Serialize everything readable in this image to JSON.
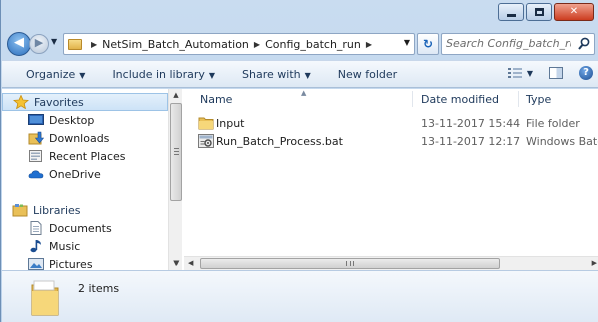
{
  "search": {
    "placeholder": "Search Config_batch_run"
  },
  "address": {
    "crumbs": [
      "NetSim_Batch_Automation",
      "Config_batch_run"
    ]
  },
  "toolbar": {
    "organize": "Organize",
    "include_in_library": "Include in library",
    "share_with": "Share with",
    "new_folder": "New folder"
  },
  "sidebar": {
    "favorites": "Favorites",
    "favorites_items": [
      "Desktop",
      "Downloads",
      "Recent Places",
      "OneDrive"
    ],
    "libraries": "Libraries",
    "libraries_items": [
      "Documents",
      "Music",
      "Pictures"
    ]
  },
  "columns": {
    "name": "Name",
    "date": "Date modified",
    "type": "Type"
  },
  "files": [
    {
      "name": "Input",
      "date": "13-11-2017 15:44",
      "type": "File folder",
      "icon": "folder-icon"
    },
    {
      "name": "Run_Batch_Process.bat",
      "date": "13-11-2017 12:17",
      "type": "Windows Batch File",
      "icon": "batch-file-icon"
    }
  ],
  "status": {
    "items": "2 items"
  },
  "colors": {
    "accent": "#1e395b",
    "chrome": "#c9dcf0",
    "selection": "#cde3f7",
    "close_button": "#cc3c1f"
  }
}
